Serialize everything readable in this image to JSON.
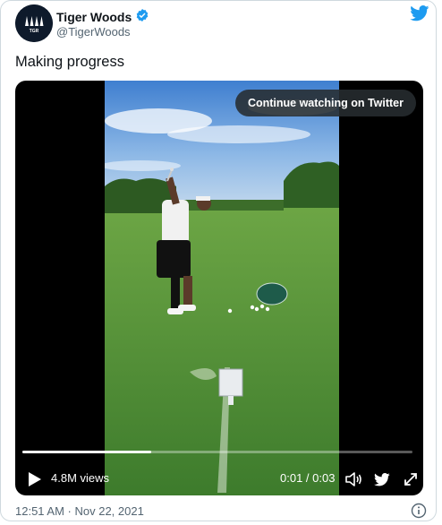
{
  "author": {
    "name": "Tiger Woods",
    "handle": "@TigerWoods",
    "verified": true,
    "avatar_text": "TGR"
  },
  "tweet": {
    "text": "Making progress",
    "timestamp": "12:51 AM · Nov 22, 2021"
  },
  "video": {
    "continue_label": "Continue watching on Twitter",
    "views": "4.8M views",
    "time": "0:01 / 0:03",
    "progress": 0.33,
    "icons": [
      "play-icon",
      "volume-icon",
      "twitter-bird-icon",
      "expand-icon"
    ]
  },
  "colors": {
    "twitter_blue": "#1d9bf0",
    "secondary_text": "#536471",
    "border": "#cfd9de"
  }
}
